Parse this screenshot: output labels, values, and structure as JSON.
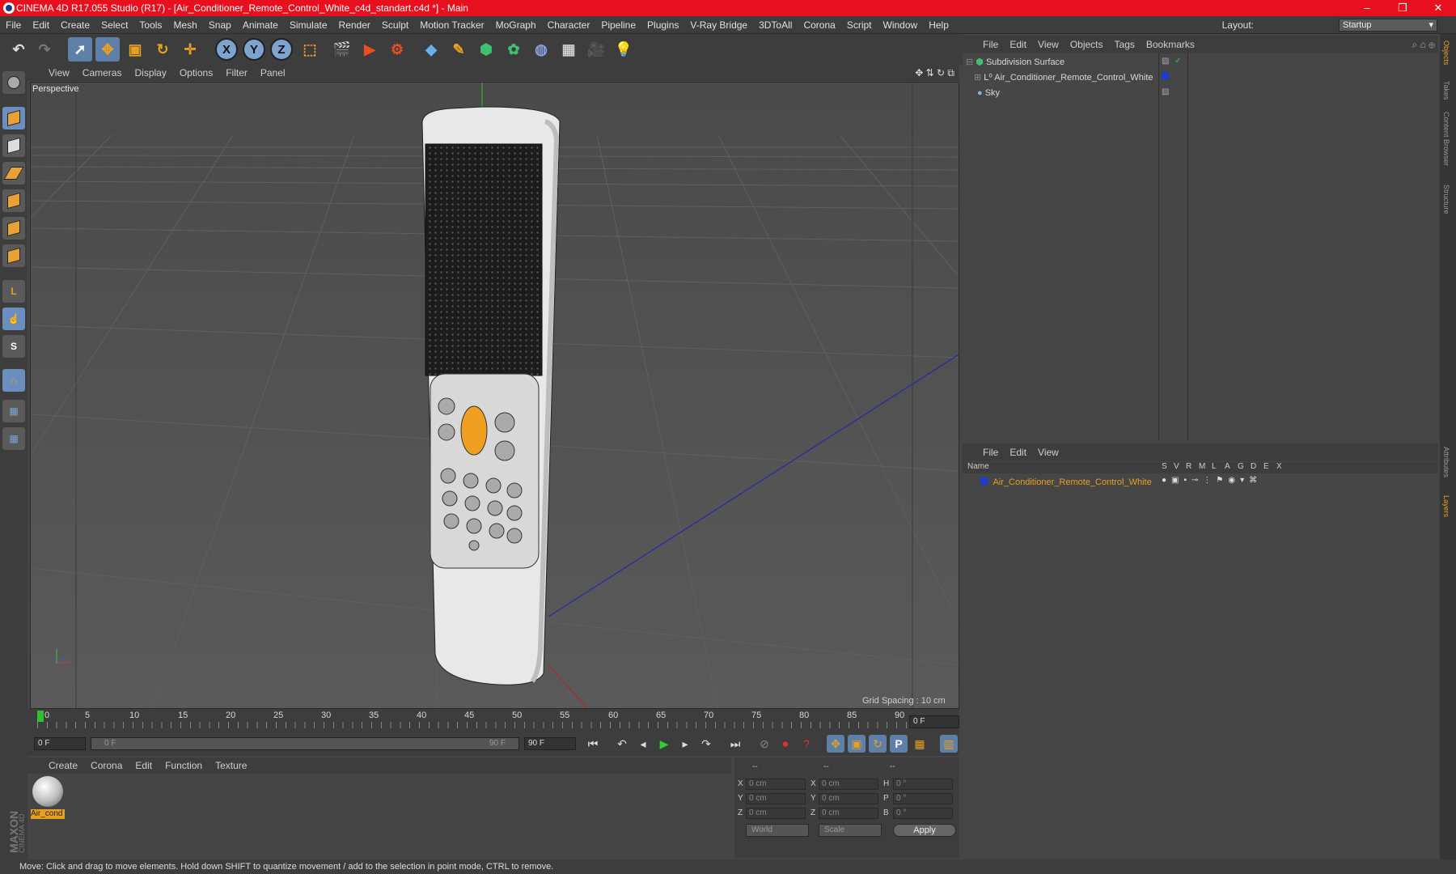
{
  "window": {
    "title": "CINEMA 4D R17.055 Studio (R17) - [Air_Conditioner_Remote_Control_White_c4d_standart.c4d *] - Main"
  },
  "menu": [
    "File",
    "Edit",
    "Create",
    "Select",
    "Tools",
    "Mesh",
    "Snap",
    "Animate",
    "Simulate",
    "Render",
    "Sculpt",
    "Motion Tracker",
    "MoGraph",
    "Character",
    "Pipeline",
    "Plugins",
    "V-Ray Bridge",
    "3DToAll",
    "Corona",
    "Script",
    "Window",
    "Help"
  ],
  "layout": {
    "label": "Layout:",
    "value": "Startup"
  },
  "toolbar": {
    "axes": [
      "X",
      "Y",
      "Z"
    ]
  },
  "viewport": {
    "menu": [
      "View",
      "Cameras",
      "Display",
      "Options",
      "Filter",
      "Panel"
    ],
    "label": "Perspective",
    "grid_spacing": "Grid Spacing : 10 cm"
  },
  "timeline": {
    "ticks": [
      "0",
      "5",
      "10",
      "15",
      "20",
      "25",
      "30",
      "35",
      "40",
      "45",
      "50",
      "55",
      "60",
      "65",
      "70",
      "75",
      "80",
      "85",
      "90"
    ],
    "current_frame": "0 F",
    "start_field": "0 F",
    "range_start": "0 F",
    "range_end": "90 F",
    "end_field": "90 F"
  },
  "material_manager": {
    "menu": [
      "Create",
      "Corona",
      "Edit",
      "Function",
      "Texture"
    ],
    "material_name": "Air_cond"
  },
  "coordinates": {
    "header": [
      "--",
      "--",
      "--"
    ],
    "rows": [
      {
        "a": "X",
        "v1": "0 cm",
        "b": "X",
        "v2": "0 cm",
        "c": "H",
        "v3": "0 °"
      },
      {
        "a": "Y",
        "v1": "0 cm",
        "b": "Y",
        "v2": "0 cm",
        "c": "P",
        "v3": "0 °"
      },
      {
        "a": "Z",
        "v1": "0 cm",
        "b": "Z",
        "v2": "0 cm",
        "c": "B",
        "v3": "0 °"
      }
    ],
    "mode": "World",
    "scale": "Scale",
    "apply": "Apply"
  },
  "object_manager": {
    "menu": [
      "File",
      "Edit",
      "View",
      "Objects",
      "Tags",
      "Bookmarks"
    ],
    "objects": [
      "Subdivision Surface",
      "Air_Conditioner_Remote_Control_White",
      "Sky"
    ]
  },
  "layers": {
    "menu": [
      "File",
      "Edit",
      "View"
    ],
    "columns": [
      "Name",
      "S",
      "V",
      "R",
      "M",
      "L",
      "A",
      "G",
      "D",
      "E",
      "X"
    ],
    "layer_name": "Air_Conditioner_Remote_Control_White"
  },
  "right_tabs": [
    "Objects",
    "Takes",
    "Content Browser",
    "Structure",
    "Attributes",
    "Layers"
  ],
  "status": "Move: Click and drag to move elements. Hold down SHIFT to quantize movement / add to the selection in point mode, CTRL to remove.",
  "colors": {
    "accent": "#e8a020",
    "titlebar": "#e8101f",
    "selected_tool": "#5e7fa8"
  }
}
